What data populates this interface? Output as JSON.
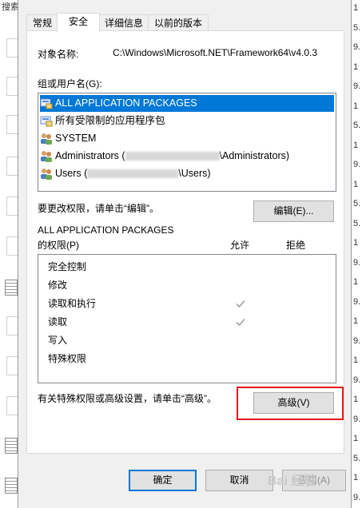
{
  "background": {
    "left_label": "搜索结",
    "right_chars": [
      "1",
      "5.",
      "9.",
      "1",
      "9.",
      "1",
      "5.",
      "1",
      "9.",
      "1",
      "5.",
      "5.",
      "1",
      "9.",
      "1",
      "9.",
      "1",
      "9.",
      "1",
      "9.",
      "1",
      "9.",
      "1",
      "5.",
      "1",
      "9."
    ]
  },
  "tabs": [
    {
      "label": "常规"
    },
    {
      "label": "安全"
    },
    {
      "label": "详细信息"
    },
    {
      "label": "以前的版本"
    }
  ],
  "object_name": {
    "label": "对象名称:",
    "value": "C:\\Windows\\Microsoft.NET\\Framework64\\v4.0.3"
  },
  "groups": {
    "label": "组或用户名(G):",
    "items": [
      {
        "name": "ALL APPLICATION PACKAGES",
        "icon": "package-group-icon",
        "selected": true
      },
      {
        "name": "所有受限制的应用程序包",
        "icon": "package-group-icon",
        "selected": false
      },
      {
        "name": "SYSTEM",
        "icon": "users-icon",
        "selected": false
      },
      {
        "name": "Administrators (",
        "suffix": "\\Administrators)",
        "icon": "users-icon",
        "selected": false
      },
      {
        "name": "Users (",
        "suffix": "\\Users)",
        "icon": "users-icon",
        "selected": false
      }
    ]
  },
  "edit_hint": "要更改权限，请单击“编辑”。",
  "edit_button": "编辑(E)...",
  "permissions": {
    "principal": "ALL APPLICATION PACKAGES",
    "label": "的权限(P)",
    "allow_header": "允许",
    "deny_header": "拒绝",
    "rows": [
      {
        "name": "完全控制",
        "allow": false,
        "deny": false
      },
      {
        "name": "修改",
        "allow": false,
        "deny": false
      },
      {
        "name": "读取和执行",
        "allow": true,
        "deny": false
      },
      {
        "name": "读取",
        "allow": true,
        "deny": false
      },
      {
        "name": "写入",
        "allow": false,
        "deny": false
      },
      {
        "name": "特殊权限",
        "allow": false,
        "deny": false
      }
    ]
  },
  "advanced_hint": "有关特殊权限或高级设置，请单击“高级”。",
  "advanced_button": "高级(V)",
  "footer": {
    "ok": "确定",
    "cancel": "取消",
    "apply": "应用(A)"
  },
  "watermark": "Bai 经验",
  "colors": {
    "selection": "#0078d7",
    "highlight_box": "#e31b1b",
    "check_gray": "#a0a0a0"
  }
}
